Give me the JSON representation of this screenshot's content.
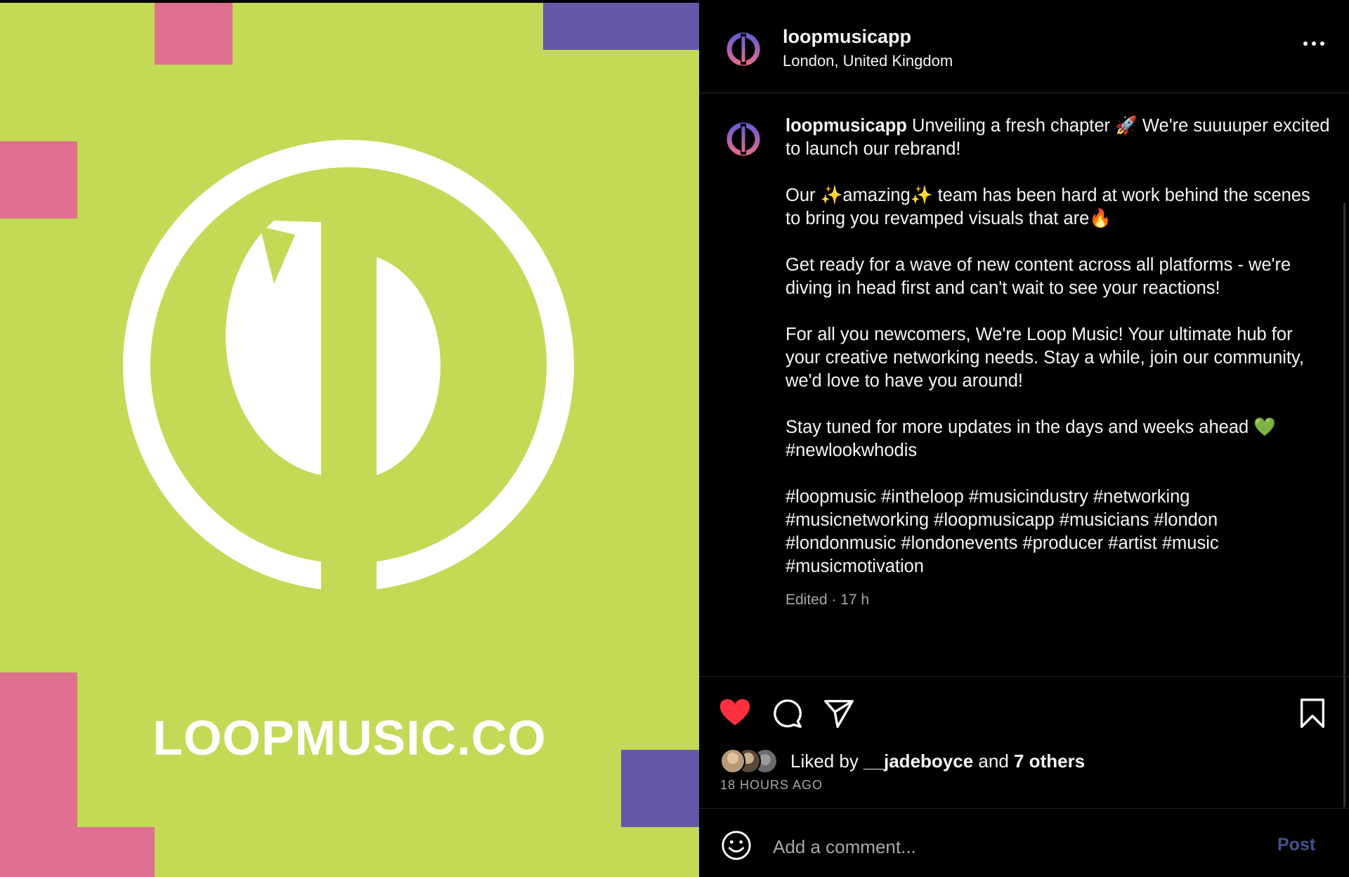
{
  "artwork": {
    "brand_text": "LOOPMUSIC.CO",
    "colors": {
      "background": "#c2da55",
      "pink": "#e07090",
      "purple": "#6459a8",
      "logo": "#ffffff"
    }
  },
  "post": {
    "username": "loopmusicapp",
    "location": "London, United Kingdom",
    "more_icon": "more-horizontal-icon",
    "caption": {
      "username": "loopmusicapp",
      "p1": " Unveiling a fresh chapter 🚀 We're suuuuper excited to launch our rebrand!",
      "p2": "Our ✨amazing✨ team has been hard at work behind the scenes to bring you revamped visuals that are🔥",
      "p3": "Get ready for a wave of new content across all platforms - we're diving in head first and can't wait to see your reactions!",
      "p4": "For all you newcomers, We're Loop Music! Your ultimate hub for your creative networking needs. Stay a while, join our community, we'd love to have you around!",
      "p5_line1": "Stay tuned for more updates in the days and weeks ahead 💚",
      "p5_line2": "#newlookwhodis",
      "hashtags": "#loopmusic #intheloop #musicindustry #networking #musicnetworking #loopmusicapp #musicians #london #londonmusic #londonevents #producer #artist #music #musicmotivation"
    },
    "meta": "Edited · 17 h",
    "actions": {
      "like": "heart-icon",
      "comment": "comment-icon",
      "share": "send-icon",
      "save": "bookmark-icon",
      "liked": true,
      "like_color": "#ff3040"
    },
    "likes": {
      "prefix": "Liked by ",
      "user": "__jadeboyce",
      "middle": " and ",
      "others": "7 others"
    },
    "time_ago": "18 HOURS AGO",
    "comment": {
      "placeholder": "Add a comment...",
      "post_label": "Post",
      "emoji_icon": "emoji-smile-icon"
    }
  }
}
